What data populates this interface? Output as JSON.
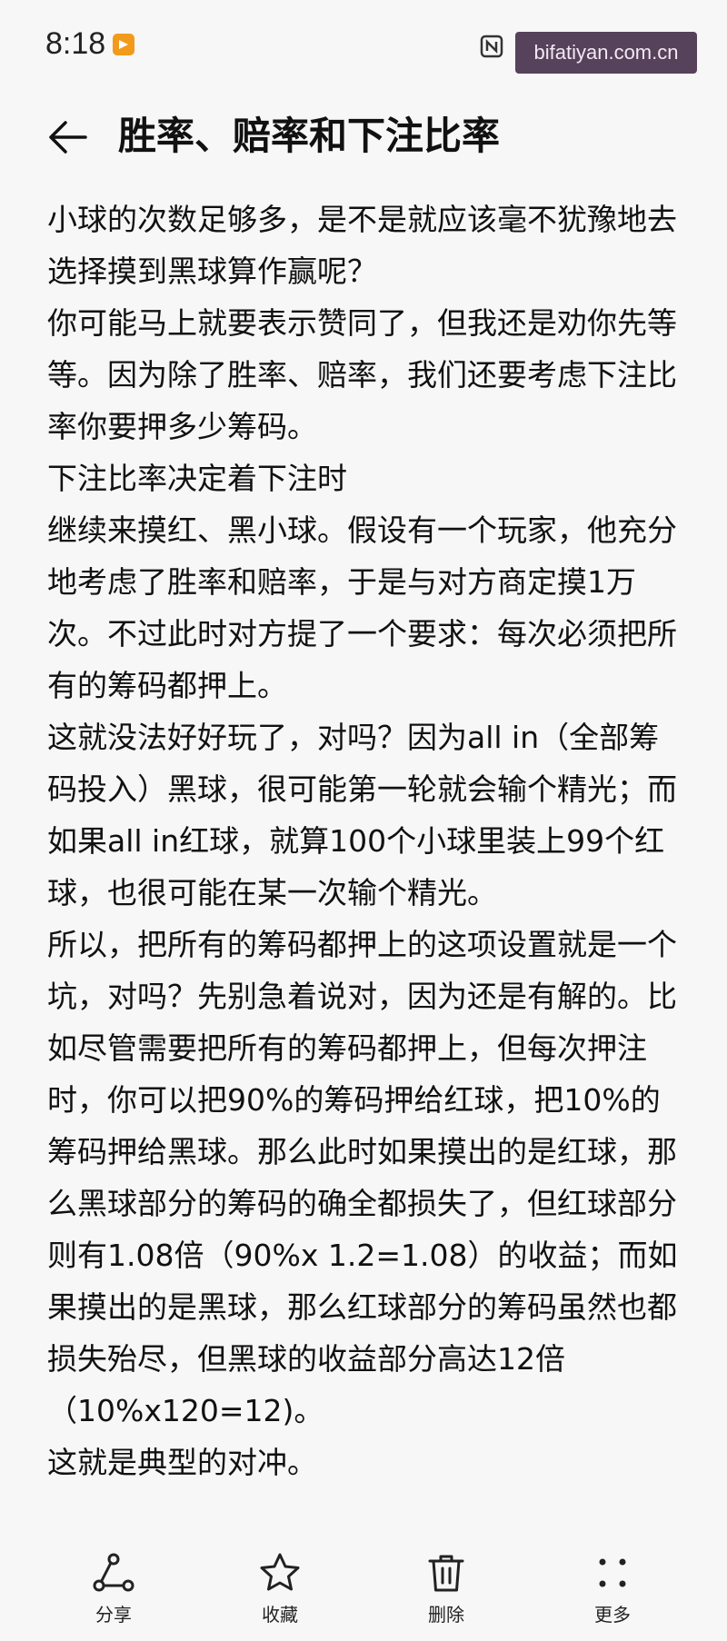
{
  "status_bar": {
    "time": "8:18",
    "watermark": "bifatiyan.com.cn"
  },
  "header": {
    "title": "胜率、赔率和下注比率"
  },
  "article": {
    "paragraphs": [
      "小球的次数足够多，是不是就应该毫不犹豫地去选择摸到黑球算作赢呢？",
      "你可能马上就要表示赞同了，但我还是劝你先等等。因为除了胜率、赔率，我们还要考虑下注比率你要押多少筹码。",
      "下注比率决定着下注时",
      "继续来摸红、黑小球。假设有一个玩家，他充分地考虑了胜率和赔率，于是与对方商定摸1万次。不过此时对方提了一个要求：每次必须把所有的筹码都押上。",
      "这就没法好好玩了，对吗？因为all in（全部筹码投入）黑球，很可能第一轮就会输个精光；而如果all in红球，就算100个小球里装上99个红球，也很可能在某一次输个精光。",
      "所以，把所有的筹码都押上的这项设置就是一个坑，对吗？先别急着说对，因为还是有解的。比如尽管需要把所有的筹码都押上，但每次押注时，你可以把90%的筹码押给红球，把10%的筹码押给黑球。那么此时如果摸出的是红球，那么黑球部分的筹码的确全都损失了，但红球部分则有1.08倍（90%x 1.2=1.08）的收益；而如果摸出的是黑球，那么红球部分的筹码虽然也都损失殆尽，但黑球的收益部分高达12倍（10%x120=12)。",
      "这就是典型的对冲。"
    ]
  },
  "toolbar": {
    "share_label": "分享",
    "favorite_label": "收藏",
    "delete_label": "删除",
    "more_label": "更多"
  },
  "icons": {
    "back": "arrow-left-icon",
    "share": "share-icon",
    "favorite": "star-icon",
    "delete": "trash-icon",
    "more": "more-dots-icon"
  },
  "colors": {
    "background": "#f7f7f7",
    "text": "#111111",
    "app_badge": "#f29a1c",
    "watermark_bg": "#3a223e"
  }
}
